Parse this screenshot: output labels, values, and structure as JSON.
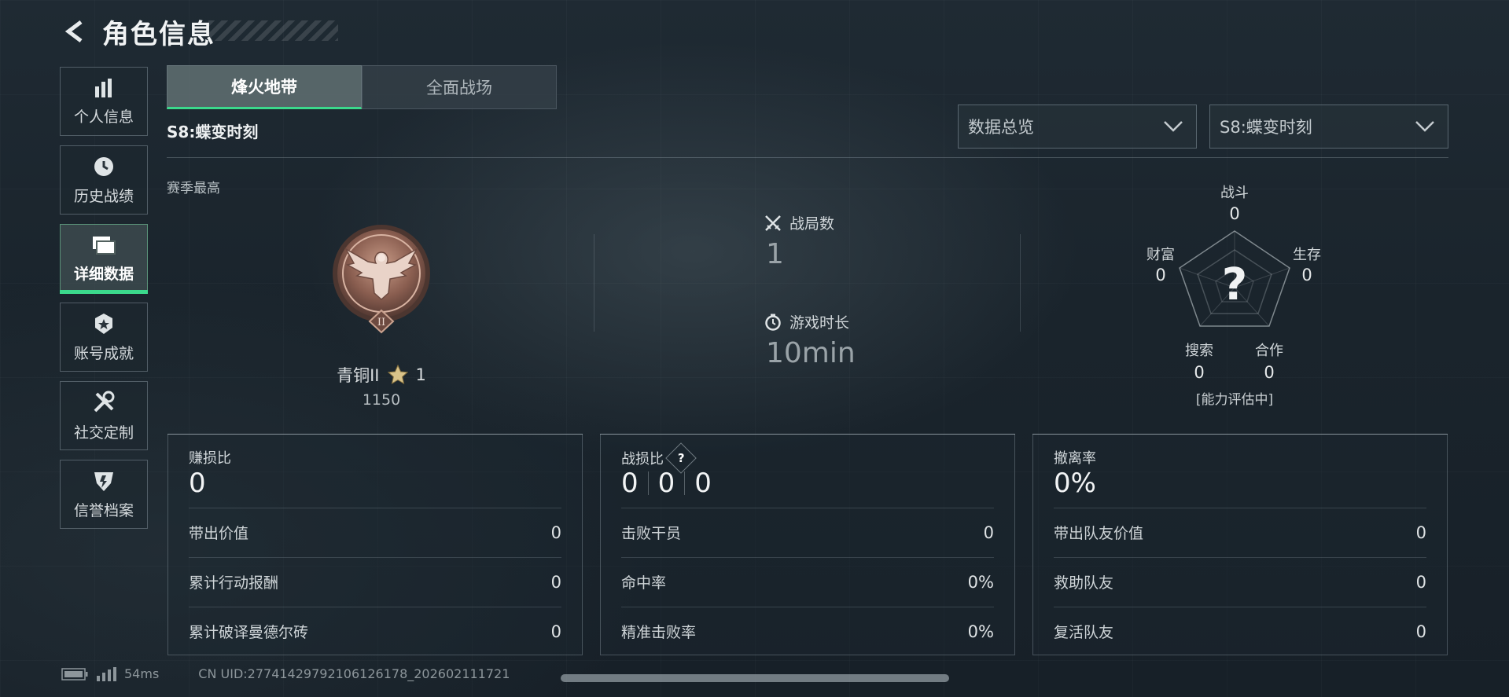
{
  "header": {
    "title": "角色信息"
  },
  "sidebar": {
    "items": [
      {
        "label": "个人信息",
        "icon": "bar-chart-icon"
      },
      {
        "label": "历史战绩",
        "icon": "history-clock-icon"
      },
      {
        "label": "详细数据",
        "icon": "folder-stack-icon",
        "active": true
      },
      {
        "label": "账号成就",
        "icon": "achievement-badge-icon"
      },
      {
        "label": "社交定制",
        "icon": "tools-icon"
      },
      {
        "label": "信誉档案",
        "icon": "credit-shield-icon"
      }
    ]
  },
  "tabs": [
    {
      "label": "烽火地带",
      "active": true
    },
    {
      "label": "全面战场"
    }
  ],
  "season_label": "S8:蝶变时刻",
  "filters": {
    "data_type": "数据总览",
    "season": "S8:蝶变时刻"
  },
  "season_high": {
    "label": "赛季最高",
    "rank_name": "青铜II",
    "stars": "1",
    "score": "1150"
  },
  "stats": {
    "matches": {
      "label": "战局数",
      "value": "1"
    },
    "playtime": {
      "label": "游戏时长",
      "value": "10min"
    }
  },
  "radar": {
    "combat": {
      "label": "战斗",
      "value": "0"
    },
    "survival": {
      "label": "生存",
      "value": "0"
    },
    "cooperation": {
      "label": "合作",
      "value": "0"
    },
    "search": {
      "label": "搜索",
      "value": "0"
    },
    "wealth": {
      "label": "财富",
      "value": "0"
    },
    "center_mark": "?",
    "status": "[能力评估中]"
  },
  "cards": {
    "profit": {
      "title": "赚损比",
      "value": "0",
      "rows": [
        {
          "label": "带出价值",
          "value": "0"
        },
        {
          "label": "累计行动报酬",
          "value": "0"
        },
        {
          "label": "累计破译曼德尔砖",
          "value": "0"
        }
      ]
    },
    "combat": {
      "title": "战损比",
      "help": "?",
      "values": [
        "0",
        "0",
        "0"
      ],
      "rows": [
        {
          "label": "击败干员",
          "value": "0"
        },
        {
          "label": "命中率",
          "value": "0%"
        },
        {
          "label": "精准击败率",
          "value": "0%"
        }
      ]
    },
    "extract": {
      "title": "撤离率",
      "value": "0%",
      "rows": [
        {
          "label": "带出队友价值",
          "value": "0"
        },
        {
          "label": "救助队友",
          "value": "0"
        },
        {
          "label": "复活队友",
          "value": "0"
        }
      ]
    }
  },
  "footer": {
    "ping": "54ms",
    "uid": "CN UID:27741429792106126178_202602111721"
  },
  "colors": {
    "accent": "#3bd98c",
    "background": "#1c262e"
  }
}
